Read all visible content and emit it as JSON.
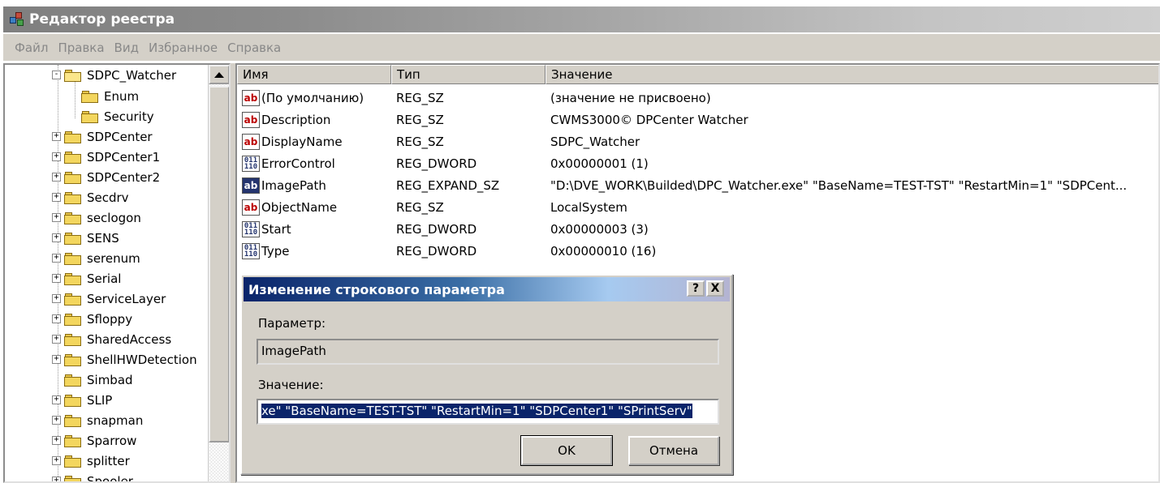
{
  "window": {
    "title": "Редактор реестра",
    "icon": "registry-editor-icon"
  },
  "menu": [
    "Файл",
    "Правка",
    "Вид",
    "Избранное",
    "Справка"
  ],
  "tree": {
    "items": [
      {
        "label": "SDPC_Watcher",
        "expander": "-",
        "open": true,
        "indent": 0
      },
      {
        "label": "Enum",
        "expander": "",
        "indent": 1
      },
      {
        "label": "Security",
        "expander": "",
        "indent": 1
      },
      {
        "label": "SDPCenter",
        "expander": "+",
        "indent": 0
      },
      {
        "label": "SDPCenter1",
        "expander": "+",
        "indent": 0
      },
      {
        "label": "SDPCenter2",
        "expander": "+",
        "indent": 0
      },
      {
        "label": "Secdrv",
        "expander": "+",
        "indent": 0
      },
      {
        "label": "seclogon",
        "expander": "+",
        "indent": 0
      },
      {
        "label": "SENS",
        "expander": "+",
        "indent": 0
      },
      {
        "label": "serenum",
        "expander": "+",
        "indent": 0
      },
      {
        "label": "Serial",
        "expander": "+",
        "indent": 0
      },
      {
        "label": "ServiceLayer",
        "expander": "+",
        "indent": 0
      },
      {
        "label": "Sfloppy",
        "expander": "+",
        "indent": 0
      },
      {
        "label": "SharedAccess",
        "expander": "+",
        "indent": 0
      },
      {
        "label": "ShellHWDetection",
        "expander": "+",
        "indent": 0
      },
      {
        "label": "Simbad",
        "expander": "",
        "indent": 0
      },
      {
        "label": "SLIP",
        "expander": "+",
        "indent": 0
      },
      {
        "label": "snapman",
        "expander": "+",
        "indent": 0
      },
      {
        "label": "Sparrow",
        "expander": "+",
        "indent": 0
      },
      {
        "label": "splitter",
        "expander": "+",
        "indent": 0
      },
      {
        "label": "Spooler",
        "expander": "+",
        "indent": 0
      }
    ]
  },
  "list": {
    "columns": [
      "Имя",
      "Тип",
      "Значение"
    ],
    "rows": [
      {
        "icon": "string-value-icon",
        "name": "(По умолчанию)",
        "type": "REG_SZ",
        "value": "(значение не присвоено)"
      },
      {
        "icon": "string-value-icon",
        "name": "Description",
        "type": "REG_SZ",
        "value": "CWMS3000© DPCenter Watcher"
      },
      {
        "icon": "string-value-icon",
        "name": "DisplayName",
        "type": "REG_SZ",
        "value": "SDPC_Watcher"
      },
      {
        "icon": "binary-value-icon",
        "name": "ErrorControl",
        "type": "REG_DWORD",
        "value": "0x00000001 (1)"
      },
      {
        "icon": "string-value-icon",
        "name": "ImagePath",
        "type": "REG_EXPAND_SZ",
        "value": "\"D:\\DVE_WORK\\Builded\\DPC_Watcher.exe\" \"BaseName=TEST-TST\" \"RestartMin=1\" \"SDPCent...",
        "selected": true
      },
      {
        "icon": "string-value-icon",
        "name": "ObjectName",
        "type": "REG_SZ",
        "value": "LocalSystem"
      },
      {
        "icon": "binary-value-icon",
        "name": "Start",
        "type": "REG_DWORD",
        "value": "0x00000003 (3)"
      },
      {
        "icon": "binary-value-icon",
        "name": "Type",
        "type": "REG_DWORD",
        "value": "0x00000010 (16)"
      }
    ]
  },
  "dialog": {
    "title": "Изменение строкового параметра",
    "help_button": "?",
    "close_button": "X",
    "param_label": "Параметр:",
    "param_value": "ImagePath",
    "value_label": "Значение:",
    "value_text": "xe\" \"BaseName=TEST-TST\" \"RestartMin=1\" \"SDPCenter1\" \"SPrintServ\"",
    "ok_label": "OK",
    "cancel_label": "Отмена"
  }
}
